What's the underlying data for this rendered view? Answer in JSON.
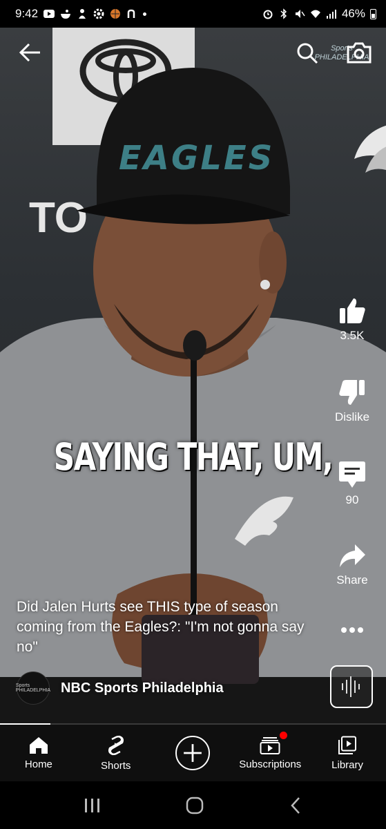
{
  "status_bar": {
    "time": "9:42",
    "battery": "46%"
  },
  "video": {
    "backdrop_text": "TO",
    "cap_text": "EAGLES",
    "watermark": "Sports PHILADELPHIA",
    "caption": "SAYING THAT, UM,",
    "progress": 0.13
  },
  "actions": {
    "like_count": "3.5K",
    "dislike_label": "Dislike",
    "comment_count": "90",
    "share_label": "Share"
  },
  "title": "Did Jalen Hurts see THIS type of season coming from the Eagles?: \"I'm not gonna say no\"",
  "channel": {
    "name": "NBC Sports Philadelphia",
    "avatar_text": "Sports PHILADELPHIA"
  },
  "bottom_nav": {
    "home": "Home",
    "shorts": "Shorts",
    "subscriptions": "Subscriptions",
    "library": "Library"
  }
}
